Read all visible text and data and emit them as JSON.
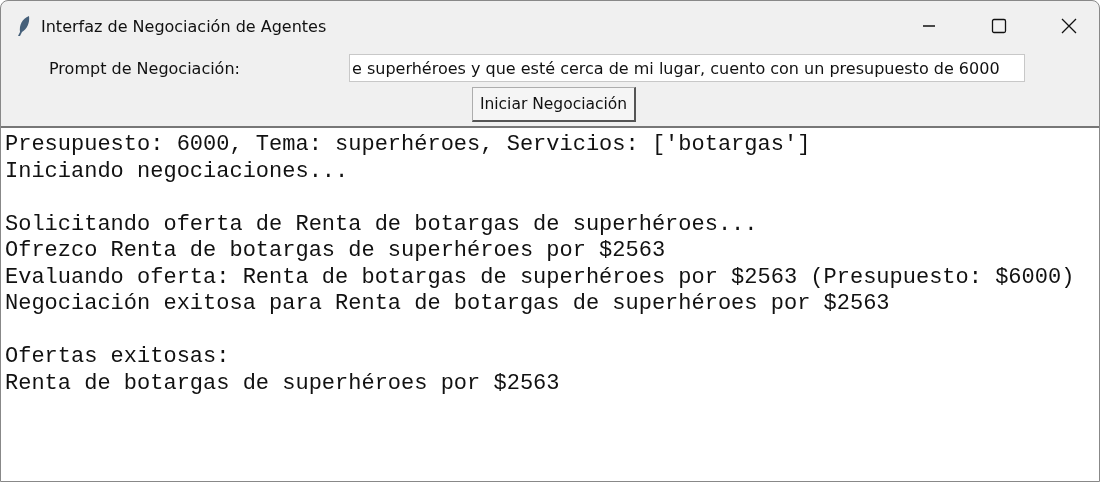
{
  "window": {
    "title": "Interfaz de Negociación de Agentes"
  },
  "prompt": {
    "label": "Prompt de Negociación:",
    "value": "e superhéroes y que esté cerca de mi lugar, cuento con un presupuesto de 6000"
  },
  "start_button": {
    "label": "Iniciar Negociación"
  },
  "output": {
    "blocks": [
      [
        "Presupuesto: 6000, Tema: superhéroes, Servicios: ['botargas']",
        "Iniciando negociaciones..."
      ],
      [
        "Solicitando oferta de Renta de botargas de superhéroes...",
        "Ofrezco Renta de botargas de superhéroes por $2563",
        "Evaluando oferta: Renta de botargas de superhéroes por $2563 (Presupuesto: $6000)",
        "Negociación exitosa para Renta de botargas de superhéroes por $2563"
      ],
      [
        "Ofertas exitosas:",
        "Renta de botargas de superhéroes por $2563"
      ]
    ]
  }
}
